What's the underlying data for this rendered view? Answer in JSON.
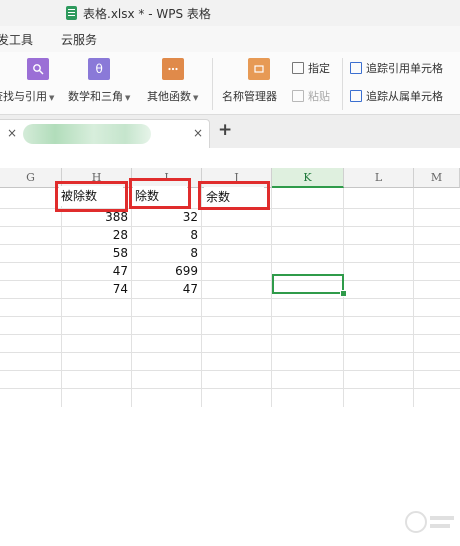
{
  "window": {
    "title": "表格.xlsx * - WPS 表格"
  },
  "menu": [
    "发工具",
    "云服务"
  ],
  "ribbon": {
    "find_ref": "查找与引用",
    "math_trig": "数学和三角",
    "other_funcs": "其他函数",
    "name_manager": "名称管理器",
    "assign": "指定",
    "paste": "粘贴",
    "trace_precedents": "追踪引用单元格",
    "trace_dependents": "追踪从属单元格"
  },
  "tabs": {
    "close_left": "×",
    "close": "×",
    "add": "+"
  },
  "columns": [
    "G",
    "H",
    "I",
    "J",
    "K",
    "L",
    "M"
  ],
  "active_column": "K",
  "headers": {
    "dividend": "被除数",
    "divisor": "除数",
    "remainder": "余数"
  },
  "rows": [
    {
      "h": "388",
      "i": "32"
    },
    {
      "h": "28",
      "i": "8"
    },
    {
      "h": "58",
      "i": "8"
    },
    {
      "h": "47",
      "i": "699"
    },
    {
      "h": "74",
      "i": "47"
    }
  ],
  "colors": {
    "accent": "#2f9b4a",
    "highlight": "#e02c2c"
  }
}
